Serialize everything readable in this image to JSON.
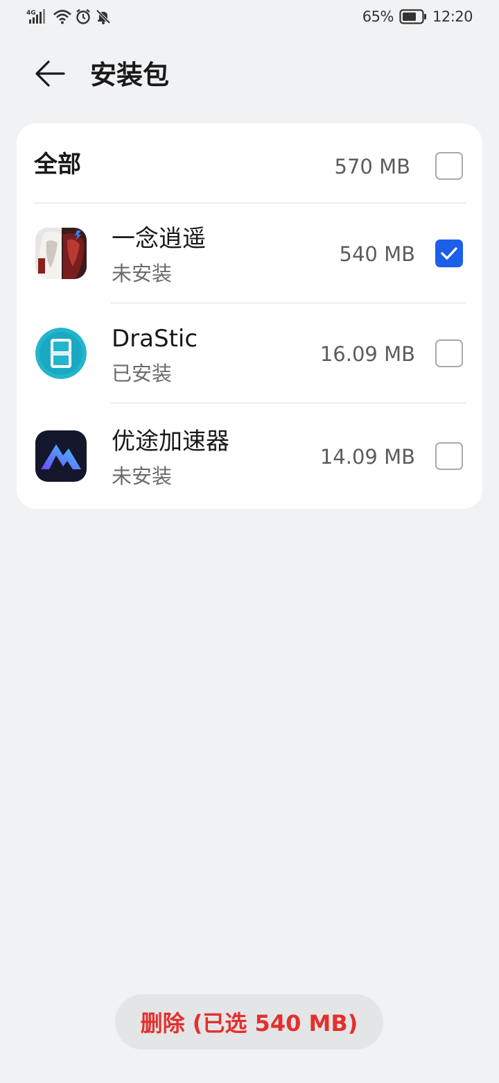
{
  "status_bar": {
    "network": "4G",
    "battery": "65%",
    "time": "12:20",
    "icons": [
      "signal-icon",
      "wifi-icon",
      "alarm-icon",
      "mute-notification-icon",
      "battery-icon"
    ]
  },
  "header": {
    "back_icon": "back-arrow-icon",
    "title": "安装包"
  },
  "list": {
    "all": {
      "label": "全部",
      "size": "570 MB",
      "checked": false
    },
    "apps": [
      {
        "name": "一念逍遥",
        "status": "未安装",
        "size": "540 MB",
        "checked": true,
        "icon": "yinianxiaoyao-app-icon"
      },
      {
        "name": "DraStic",
        "status": "已安装",
        "size": "16.09 MB",
        "checked": false,
        "icon": "drastic-app-icon"
      },
      {
        "name": "优途加速器",
        "status": "未安装",
        "size": "14.09 MB",
        "checked": false,
        "icon": "youtu-accelerator-app-icon"
      }
    ]
  },
  "footer": {
    "delete_label": "删除 (已选 540 MB)"
  },
  "colors": {
    "background": "#f1f2f4",
    "card": "#ffffff",
    "accent": "#1c5fe8",
    "danger": "#e3302c"
  }
}
